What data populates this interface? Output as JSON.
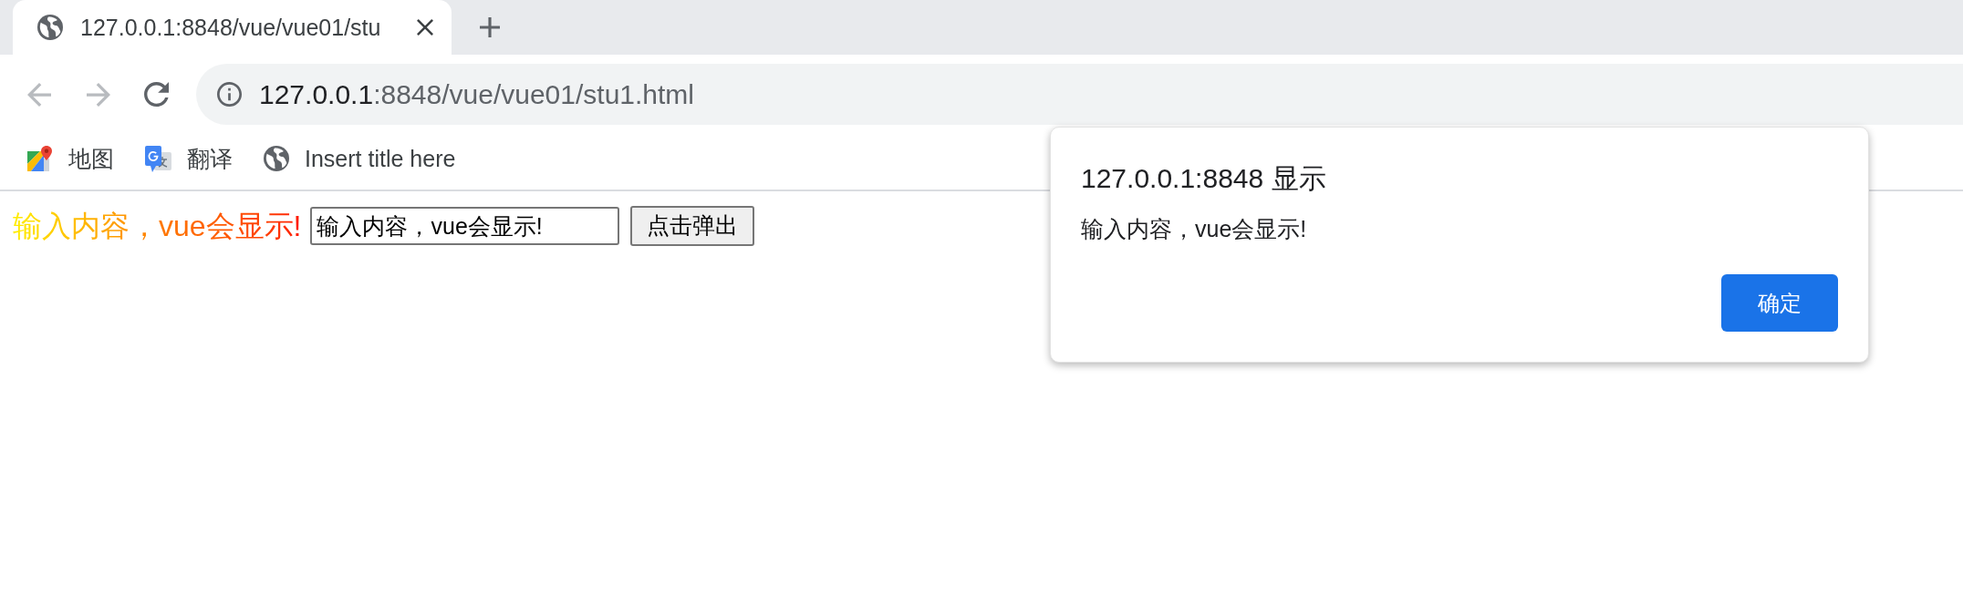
{
  "browser": {
    "tabs": [
      {
        "title": "127.0.0.1:8848/vue/vue01/stu",
        "selected": true
      }
    ],
    "navigation": {
      "back": {
        "disabled": true
      },
      "forward": {
        "disabled": true
      }
    },
    "address_bar": {
      "host": "127.0.0.1",
      "path": ":8848/vue/vue01/stu1.html"
    },
    "bookmarks": [
      {
        "kind": "maps",
        "label": "地图"
      },
      {
        "kind": "translate",
        "label": "翻译"
      },
      {
        "kind": "page",
        "label": "Insert title here"
      }
    ]
  },
  "page": {
    "heading": "输入内容，vue会显示!",
    "input": {
      "value": "输入内容，vue会显示!"
    },
    "button": "点击弹出"
  },
  "dialog": {
    "title": "127.0.0.1:8848 显示",
    "message": "输入内容，vue会显示!",
    "buttons": [
      "确定"
    ]
  }
}
